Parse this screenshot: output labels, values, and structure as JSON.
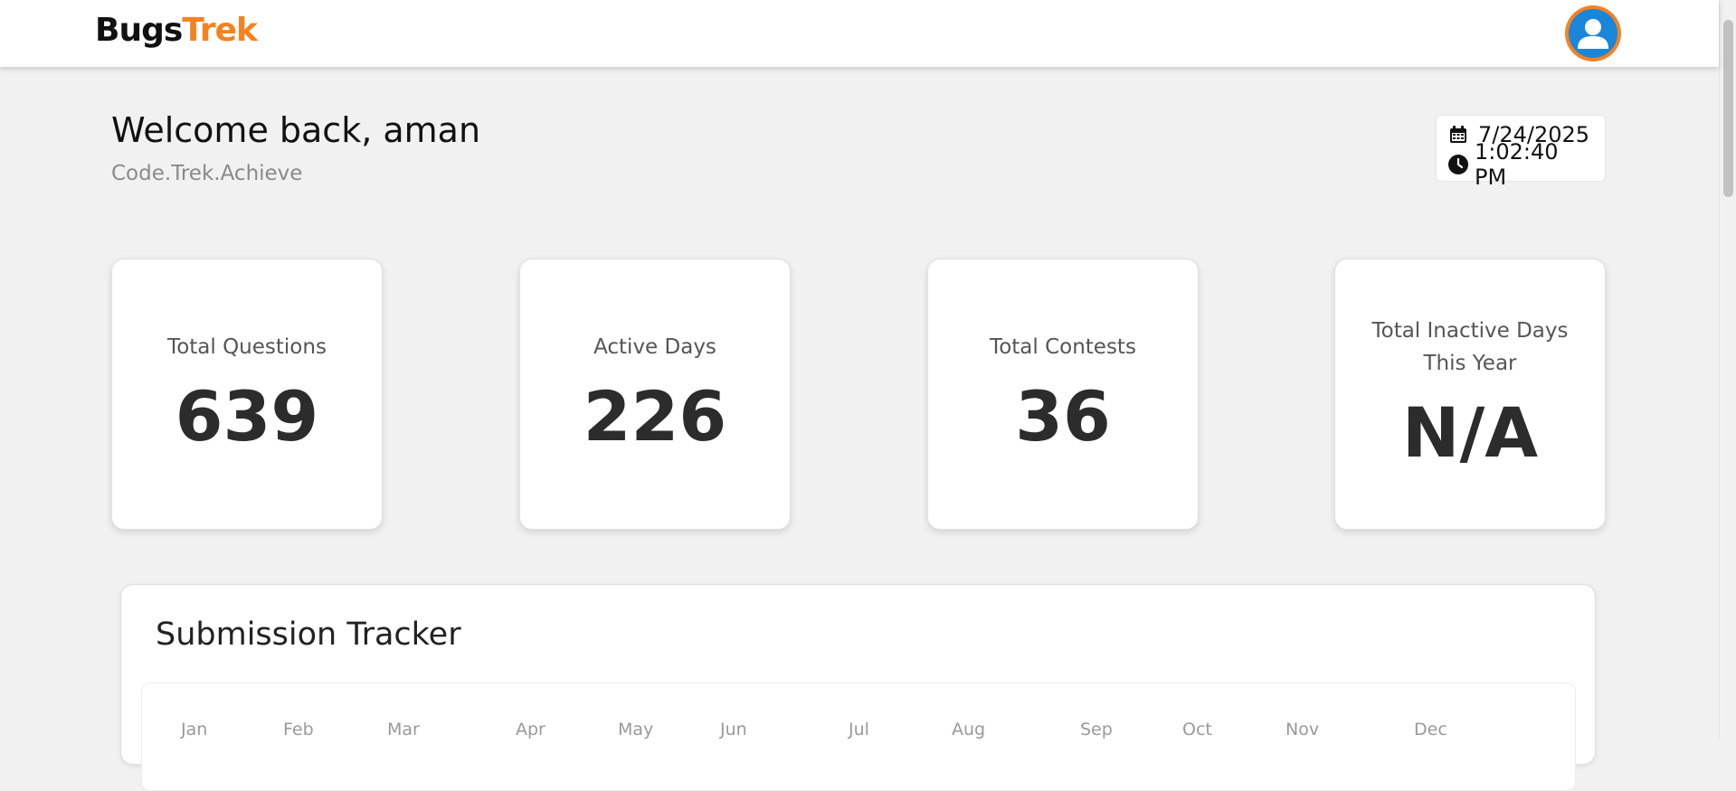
{
  "nav": {
    "logo_part1": "Bugs",
    "logo_part2": "Trek",
    "brand_color": "#f58220",
    "avatar_icon": "user-avatar-icon"
  },
  "welcome": {
    "title": "Welcome back, aman",
    "tagline": "Code.Trek.Achieve"
  },
  "datetime": {
    "date": "7/24/2025",
    "time": "1:02:40 PM",
    "date_icon": "calendar-icon",
    "time_icon": "clock-icon"
  },
  "stats": [
    {
      "label": "Total Questions",
      "value": "639"
    },
    {
      "label": "Active Days",
      "value": "226"
    },
    {
      "label": "Total Contests",
      "value": "36"
    },
    {
      "label": "Total Inactive Days This Year",
      "value": "N/A"
    }
  ],
  "tracker": {
    "title": "Submission Tracker",
    "months": [
      "Jan",
      "Feb",
      "Mar",
      "Apr",
      "May",
      "Jun",
      "Jul",
      "Aug",
      "Sep",
      "Oct",
      "Nov",
      "Dec"
    ]
  }
}
